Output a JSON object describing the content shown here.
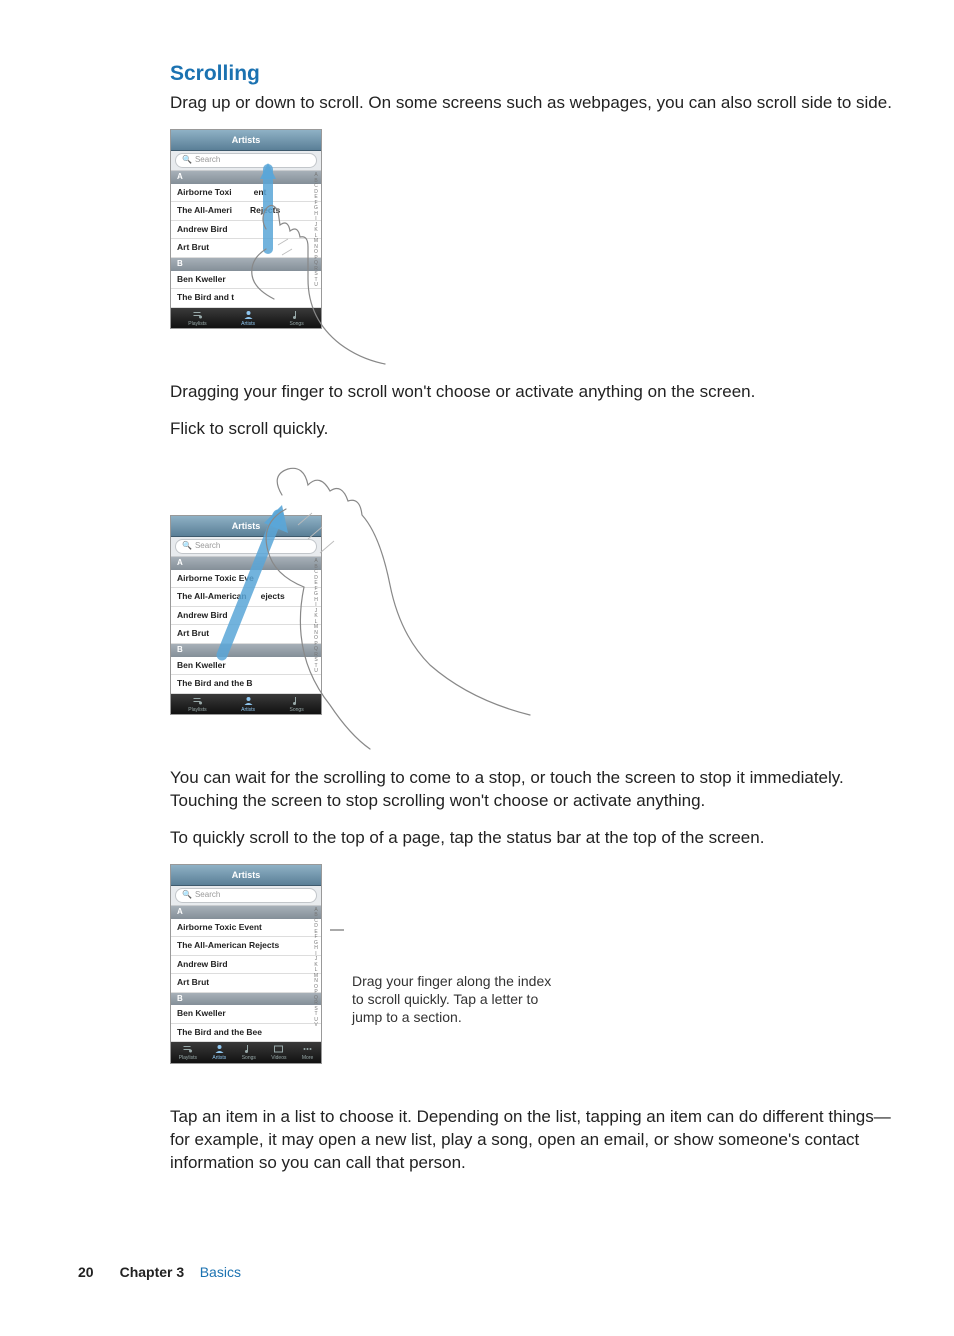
{
  "heading": "Scrolling",
  "intro": "Drag up or down to scroll. On some screens such as webpages, you can also scroll side to side.",
  "after_drag": "Dragging your finger to scroll won't choose or activate anything on the screen.",
  "flick_intro": "Flick to scroll quickly.",
  "after_flick": "You can wait for the scrolling to come to a stop, or touch the screen to stop it immediately. Touching the screen to stop scrolling won't choose or activate anything.",
  "top_scroll": "To quickly scroll to the top of a page, tap the status bar at the top of the screen.",
  "callout": "Drag your finger along the index to scroll quickly. Tap a letter to jump to a section.",
  "tap_item": "Tap an item in a list to choose it. Depending on the list, tapping an item can do different things—for example, it may open a new list, play a song, open an email, or show someone's contact information so you can call that person.",
  "footer": {
    "page": "20",
    "chapter_label": "Chapter 3",
    "chapter_name": "Basics"
  },
  "ui": {
    "title": "Artists",
    "search_icon": "🔍",
    "search_placeholder": "Search",
    "letter_a": "A",
    "letter_b": "B",
    "artist_1": "Airborne Toxic Event",
    "artist_2": "The All-American Rejects",
    "artist_3": "Andrew Bird",
    "artist_4": "Art Brut",
    "artist_5": "Ben Kweller",
    "artist_6": "The Bird and the Bee",
    "artist_1_trunc_drag": {
      "pre": "Airborne Toxi",
      "post": "ent"
    },
    "artist_2_trunc_drag": {
      "pre": "The All-Ameri",
      "post": "Rejects"
    },
    "artist_6_trunc_drag": "The Bird and t",
    "artist_1_trunc_flick": "Airborne Toxic Eve",
    "artist_2_trunc_flick": {
      "pre": "The All-American",
      "post": "ejects"
    },
    "artist_6_trunc_flick": "The Bird and the B",
    "index_letters": [
      "A",
      "B",
      "C",
      "D",
      "E",
      "F",
      "G",
      "H",
      "I",
      "J",
      "K",
      "L",
      "M",
      "N",
      "O",
      "P",
      "Q",
      "R",
      "S",
      "T",
      "U",
      "V"
    ],
    "tabs": {
      "playlists": "Playlists",
      "artists": "Artists",
      "songs": "Songs",
      "videos": "Videos",
      "more": "More"
    }
  }
}
